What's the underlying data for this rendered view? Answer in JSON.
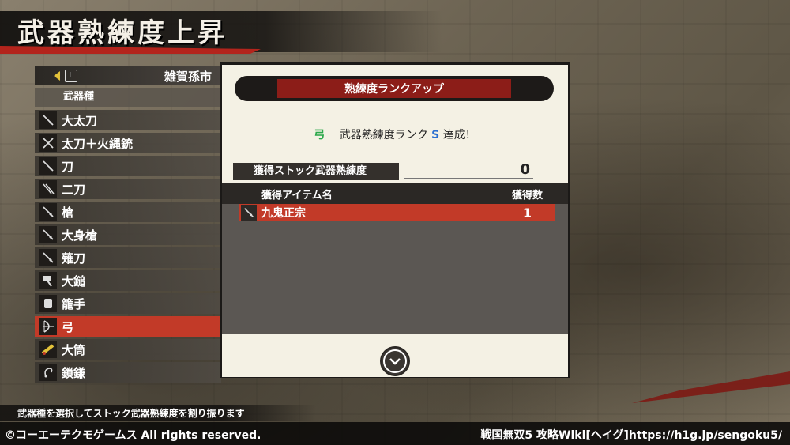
{
  "screen_title": "武器熟練度上昇",
  "character": {
    "l_button": "L",
    "name": "雑賀孫市"
  },
  "category_label": "武器種",
  "weapon_types": [
    {
      "label": "大太刀",
      "icon": "odachi-icon"
    },
    {
      "label": "太刀＋火縄銃",
      "icon": "tachi-gun-icon"
    },
    {
      "label": "刀",
      "icon": "katana-icon"
    },
    {
      "label": "二刀",
      "icon": "dual-swords-icon"
    },
    {
      "label": "槍",
      "icon": "spear-icon"
    },
    {
      "label": "大身槍",
      "icon": "great-spear-icon"
    },
    {
      "label": "薙刀",
      "icon": "naginata-icon"
    },
    {
      "label": "大鎚",
      "icon": "hammer-icon"
    },
    {
      "label": "籠手",
      "icon": "gauntlet-icon"
    },
    {
      "label": "弓",
      "icon": "bow-icon",
      "selected": true
    },
    {
      "label": "大筒",
      "icon": "cannon-icon"
    },
    {
      "label": "鎖鎌",
      "icon": "kusarigama-icon"
    }
  ],
  "dialog": {
    "title": "熟練度ランクアップ",
    "achievement": {
      "weapon": "弓",
      "text_before": "武器熟練度ランク",
      "rank": "S",
      "text_after": "達成！"
    },
    "stock_label": "獲得ストック武器熟練度",
    "stock_value": "0",
    "table": {
      "col_name": "獲得アイテム名",
      "col_count": "獲得数",
      "rows": [
        {
          "name": "九鬼正宗",
          "count": "1"
        }
      ]
    }
  },
  "hint": "武器種を選択してストック武器熟練度を割り振ります",
  "footer": {
    "copyright": "©コーエーテクモゲームス All rights reserved.",
    "wiki": "戦国無双5 攻略Wiki[ヘイグ]https://h1g.jp/sengoku5/"
  },
  "colors": {
    "accent_red": "#c23a28",
    "dialog_bg": "#f4f1e4",
    "bow_green": "#2aa84a",
    "rank_blue": "#2a6fd0"
  }
}
